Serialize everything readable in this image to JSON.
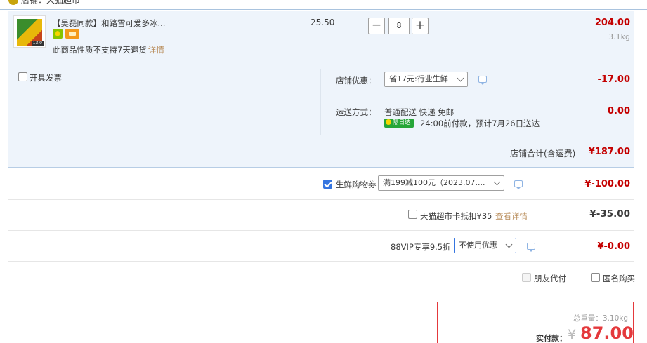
{
  "shop": {
    "label": "店铺：天猫超市"
  },
  "item": {
    "title": "【吴磊同款】和路雪可爱多冰...",
    "note": "此商品性质不支持7天退货",
    "detail_link": "详情",
    "unit_price": "25.50",
    "quantity": "8",
    "minus": "−",
    "plus": "+",
    "subtotal": "204.00",
    "weight": "3.1kg"
  },
  "options": {
    "invoice_label": "开具发票",
    "store_discount_label": "店铺优惠：",
    "store_discount_value": "省17元:行业生鲜",
    "store_discount_amount": "-17.00",
    "shipping_label": "运送方式：",
    "shipping_method": "普通配送 快递 免邮",
    "next_day_tag": "隔日达",
    "shipping_note": "24:00前付款，预计7月26日送达",
    "shipping_amount": "0.00"
  },
  "store_total": {
    "label": "店铺合计(含运费)",
    "amount": "¥187.00"
  },
  "coupon": {
    "label": "生鲜购物券",
    "value": "满199减100元（2023.07....",
    "amount": "¥-100.00",
    "checked": true
  },
  "tmall_card": {
    "label": "天猫超市卡抵扣¥35",
    "link": "查看详情",
    "amount": "¥-35.00"
  },
  "vip": {
    "label": "88VIP专享9.5折",
    "value": "不使用优惠",
    "amount": "¥-0.00"
  },
  "extras": {
    "friend_pay": "朋友代付",
    "anonymous": "匿名购买"
  },
  "summary": {
    "weight": "总重量：3.10kg",
    "pay_label": "实付款：",
    "currency": "¥",
    "pay_amount": "87.00"
  },
  "colors": {
    "accent_red": "#c40000",
    "pay_red": "#e4393c",
    "row_bg": "#eef4fb",
    "check_blue": "#3575e0"
  }
}
